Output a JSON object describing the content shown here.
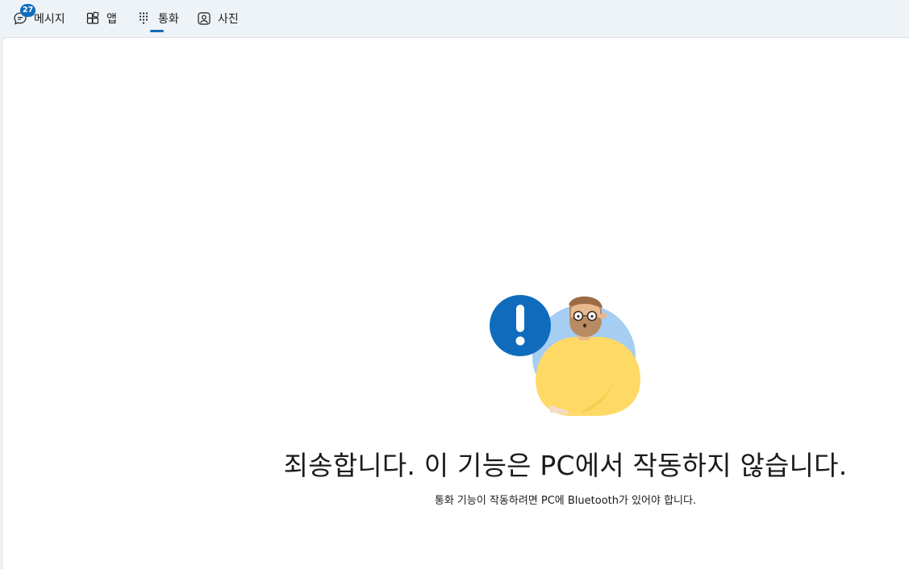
{
  "tabs": [
    {
      "label": "메시지",
      "icon": "chat-bubble-icon",
      "badge": "27"
    },
    {
      "label": "앱",
      "icon": "apps-grid-icon"
    },
    {
      "label": "통화",
      "icon": "dialpad-icon",
      "selected": true
    },
    {
      "label": "사진",
      "icon": "photo-icon"
    }
  ],
  "error": {
    "title": "죄송합니다. 이 기능은 PC에서 작동하지 않습니다.",
    "subtitle": "통화 기능이 작동하려면 PC에 Bluetooth가 있어야 합니다."
  },
  "colors": {
    "accent": "#0f6cbd",
    "alert": "#0f6cbd",
    "shirt": "#ffd966",
    "background_circle": "#a6cdf2"
  }
}
